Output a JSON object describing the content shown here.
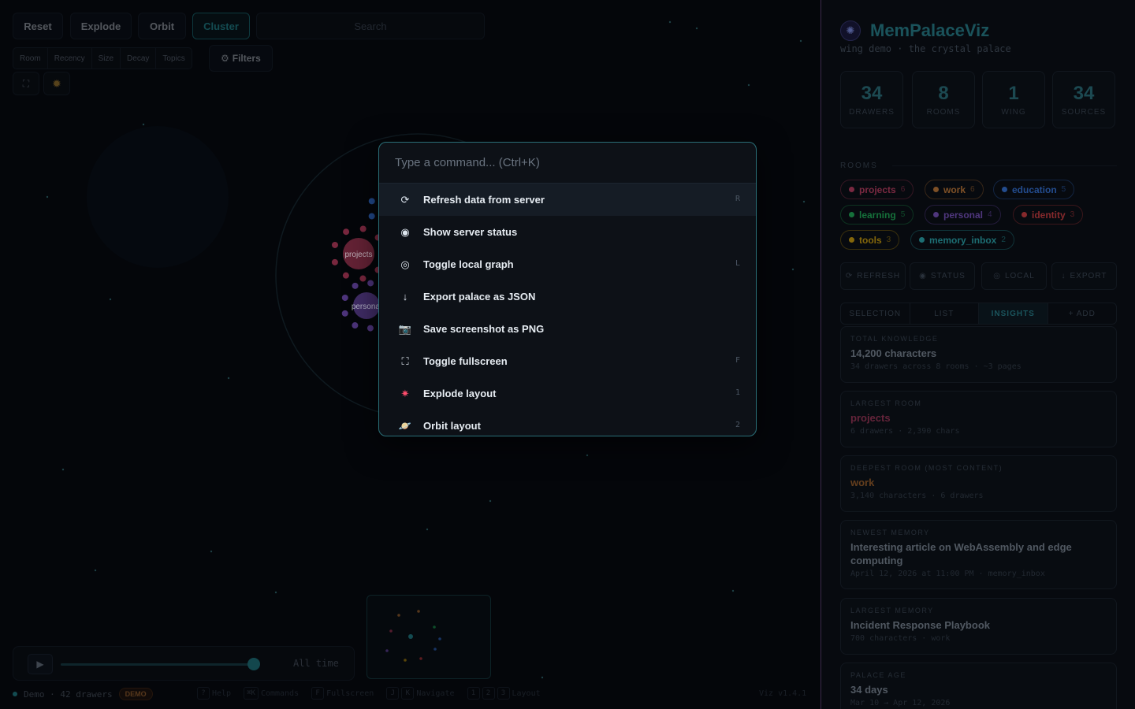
{
  "toolbar": {
    "reset": "Reset",
    "explode": "Explode",
    "orbit": "Orbit",
    "cluster": "Cluster",
    "search_placeholder": "Search",
    "segments": [
      "Room",
      "Recency",
      "Size",
      "Decay",
      "Topics"
    ],
    "filters": "Filters",
    "filters_icon": "gear-icon",
    "fullscreen_icon": "expand-icon",
    "sun_icon": "sun-icon"
  },
  "graph": {
    "labels": [
      "projects",
      "personal"
    ],
    "colors": {
      "projects": "#d9446a",
      "personal": "#8a5bd8",
      "work": "#e08a3a",
      "education": "#3b82f6",
      "learning": "#22c55e",
      "identity": "#ef4444",
      "tools": "#eab308",
      "memory_inbox": "#2fc0c6"
    }
  },
  "timeline": {
    "play_icon": "play-icon",
    "label": "All time",
    "progress": 1.0
  },
  "footer": {
    "status": "Demo · 42 drawers",
    "badge": "DEMO",
    "shortcuts": [
      {
        "keys": [
          "?"
        ],
        "label": "Help"
      },
      {
        "keys": [
          "⌘K"
        ],
        "label": "Commands"
      },
      {
        "keys": [
          "F"
        ],
        "label": "Fullscreen"
      },
      {
        "keys": [
          "J",
          "K"
        ],
        "label": "Navigate"
      },
      {
        "keys": [
          "1",
          "2",
          "3"
        ],
        "label": "Layout"
      }
    ],
    "version": "Viz v1.4.1"
  },
  "sidebar": {
    "title": "MemPalaceViz",
    "subtitle": "wing demo · the crystal palace",
    "stats": [
      {
        "value": "34",
        "label": "DRAWERS"
      },
      {
        "value": "8",
        "label": "ROOMS"
      },
      {
        "value": "1",
        "label": "WING"
      },
      {
        "value": "34",
        "label": "SOURCES"
      }
    ],
    "rooms_label": "ROOMS",
    "rooms": [
      {
        "name": "projects",
        "count": "6",
        "color": "#d9446a"
      },
      {
        "name": "work",
        "count": "6",
        "color": "#e08a3a"
      },
      {
        "name": "education",
        "count": "5",
        "color": "#3b82f6"
      },
      {
        "name": "learning",
        "count": "5",
        "color": "#22c55e"
      },
      {
        "name": "personal",
        "count": "4",
        "color": "#8a5bd8"
      },
      {
        "name": "identity",
        "count": "3",
        "color": "#ef4444"
      },
      {
        "name": "tools",
        "count": "3",
        "color": "#eab308"
      },
      {
        "name": "memory_inbox",
        "count": "2",
        "color": "#2fc0c6"
      }
    ],
    "actions": [
      {
        "label": "REFRESH",
        "icon": "refresh-icon"
      },
      {
        "label": "STATUS",
        "icon": "status-icon"
      },
      {
        "label": "LOCAL",
        "icon": "target-icon"
      },
      {
        "label": "EXPORT",
        "icon": "download-icon"
      }
    ],
    "tabs": [
      "SELECTION",
      "LIST",
      "INSIGHTS",
      "+ ADD"
    ],
    "active_tab": "INSIGHTS",
    "insights": [
      {
        "key": "TOTAL KNOWLEDGE",
        "value": "14,200 characters",
        "sub": "34 drawers across 8 rooms · ~3 pages"
      },
      {
        "key": "LARGEST ROOM",
        "value": "projects",
        "sub": "6 drawers · 2,390 chars"
      },
      {
        "key": "DEEPEST ROOM (MOST CONTENT)",
        "value": "work",
        "sub": "3,140 characters · 6 drawers"
      },
      {
        "key": "NEWEST MEMORY",
        "value": "Interesting article on WebAssembly and edge computing",
        "sub": "April 12, 2026 at 11:00 PM · memory_inbox"
      },
      {
        "key": "LARGEST MEMORY",
        "value": "Incident Response Playbook",
        "sub": "700 characters · work"
      },
      {
        "key": "PALACE AGE",
        "value": "34 days",
        "sub": "Mar 10 → Apr 12, 2026"
      }
    ]
  },
  "palette": {
    "placeholder": "Type a command... (Ctrl+K)",
    "items": [
      {
        "label": "Refresh data from server",
        "key": "R",
        "icon": "refresh-icon",
        "glyph": "⟳"
      },
      {
        "label": "Show server status",
        "key": "",
        "icon": "status-icon",
        "glyph": "◉"
      },
      {
        "label": "Toggle local graph",
        "key": "L",
        "icon": "target-icon",
        "glyph": "◎"
      },
      {
        "label": "Export palace as JSON",
        "key": "",
        "icon": "download-icon",
        "glyph": "↓"
      },
      {
        "label": "Save screenshot as PNG",
        "key": "",
        "icon": "camera-icon",
        "glyph": "📷"
      },
      {
        "label": "Toggle fullscreen",
        "key": "F",
        "icon": "fullscreen-icon",
        "glyph": "⛶"
      },
      {
        "label": "Explode layout",
        "key": "1",
        "icon": "explosion-icon",
        "glyph": "✷"
      },
      {
        "label": "Orbit layout",
        "key": "2",
        "icon": "planet-icon",
        "glyph": "🪐"
      }
    ]
  }
}
